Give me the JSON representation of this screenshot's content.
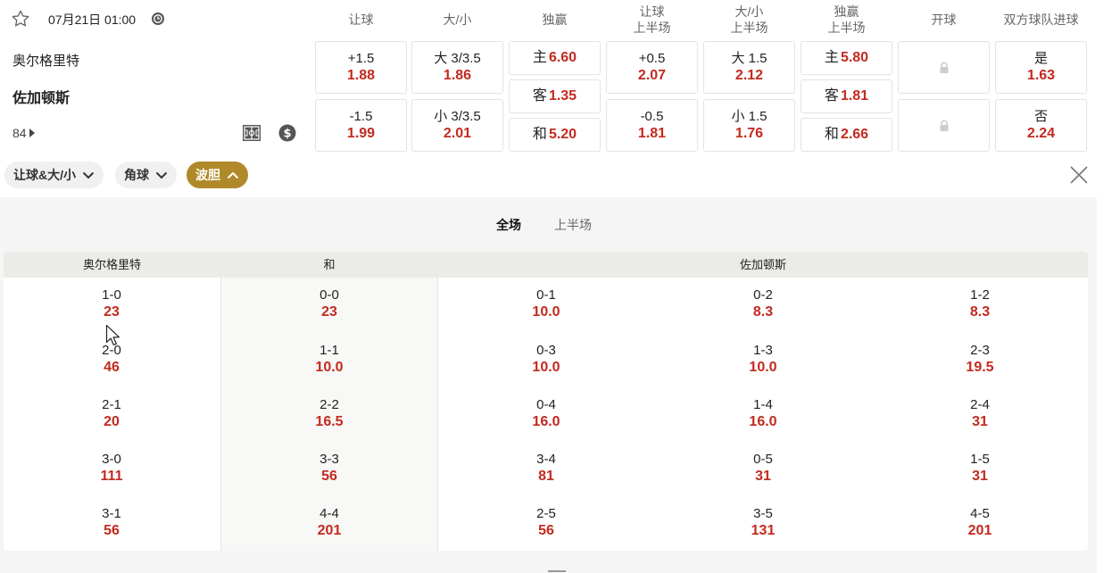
{
  "match": {
    "datetime": "07月21日 01:00",
    "home": "奥尔格里特",
    "away": "佐加顿斯",
    "more_markets": "84"
  },
  "columns": {
    "handicap": "让球",
    "total": "大/小",
    "moneyline": "独赢",
    "handicap_ht_l1": "让球",
    "handicap_ht_l2": "上半场",
    "total_ht_l1": "大/小",
    "total_ht_l2": "上半场",
    "moneyline_ht_l1": "独赢",
    "moneyline_ht_l2": "上半场",
    "kickoff": "开球",
    "btts": "双方球队进球"
  },
  "odds": {
    "handicap": [
      {
        "label": "+1.5",
        "odd": "1.88"
      },
      {
        "label": "-1.5",
        "odd": "1.99"
      }
    ],
    "total": [
      {
        "label": "大 3/3.5",
        "odd": "1.86"
      },
      {
        "label": "小 3/3.5",
        "odd": "2.01"
      }
    ],
    "moneyline": [
      {
        "label": "主",
        "odd": "6.60"
      },
      {
        "label": "客",
        "odd": "1.35"
      },
      {
        "label": "和",
        "odd": "5.20"
      }
    ],
    "handicap_ht": [
      {
        "label": "+0.5",
        "odd": "2.07"
      },
      {
        "label": "-0.5",
        "odd": "1.81"
      }
    ],
    "total_ht": [
      {
        "label": "大 1.5",
        "odd": "2.12"
      },
      {
        "label": "小 1.5",
        "odd": "1.76"
      }
    ],
    "moneyline_ht": [
      {
        "label": "主",
        "odd": "5.80"
      },
      {
        "label": "客",
        "odd": "1.81"
      },
      {
        "label": "和",
        "odd": "2.66"
      }
    ],
    "btts": [
      {
        "label": "是",
        "odd": "1.63"
      },
      {
        "label": "否",
        "odd": "2.24"
      }
    ]
  },
  "filters": [
    "让球&大/小",
    "角球",
    "波胆"
  ],
  "tabs": [
    "全场",
    "上半场"
  ],
  "score_grid": {
    "headers": {
      "home": "奥尔格里特",
      "draw": "和",
      "away": "佐加顿斯"
    },
    "columns": [
      [
        {
          "s": "1-0",
          "o": "23"
        },
        {
          "s": "2-0",
          "o": "46"
        },
        {
          "s": "2-1",
          "o": "20"
        },
        {
          "s": "3-0",
          "o": "111"
        },
        {
          "s": "3-1",
          "o": "56"
        }
      ],
      [
        {
          "s": "0-0",
          "o": "23"
        },
        {
          "s": "1-1",
          "o": "10.0"
        },
        {
          "s": "2-2",
          "o": "16.5"
        },
        {
          "s": "3-3",
          "o": "56"
        },
        {
          "s": "4-4",
          "o": "201"
        }
      ],
      [
        {
          "s": "0-1",
          "o": "10.0"
        },
        {
          "s": "0-3",
          "o": "10.0"
        },
        {
          "s": "0-4",
          "o": "16.0"
        },
        {
          "s": "3-4",
          "o": "81"
        },
        {
          "s": "2-5",
          "o": "56"
        }
      ],
      [
        {
          "s": "0-2",
          "o": "8.3"
        },
        {
          "s": "1-3",
          "o": "10.0"
        },
        {
          "s": "1-4",
          "o": "16.0"
        },
        {
          "s": "0-5",
          "o": "31"
        },
        {
          "s": "3-5",
          "o": "131"
        }
      ],
      [
        {
          "s": "1-2",
          "o": "8.3"
        },
        {
          "s": "2-3",
          "o": "19.5"
        },
        {
          "s": "2-4",
          "o": "31"
        },
        {
          "s": "1-5",
          "o": "31"
        },
        {
          "s": "4-5",
          "o": "201"
        }
      ]
    ]
  },
  "colors": {
    "odds": "#c32a1f",
    "accent": "#b08a2a"
  },
  "icons": [
    "star-icon",
    "clock-icon",
    "pitch-icon",
    "dollar-icon",
    "lock-icon",
    "chevron-down-icon",
    "chevron-up-icon",
    "close-icon"
  ]
}
